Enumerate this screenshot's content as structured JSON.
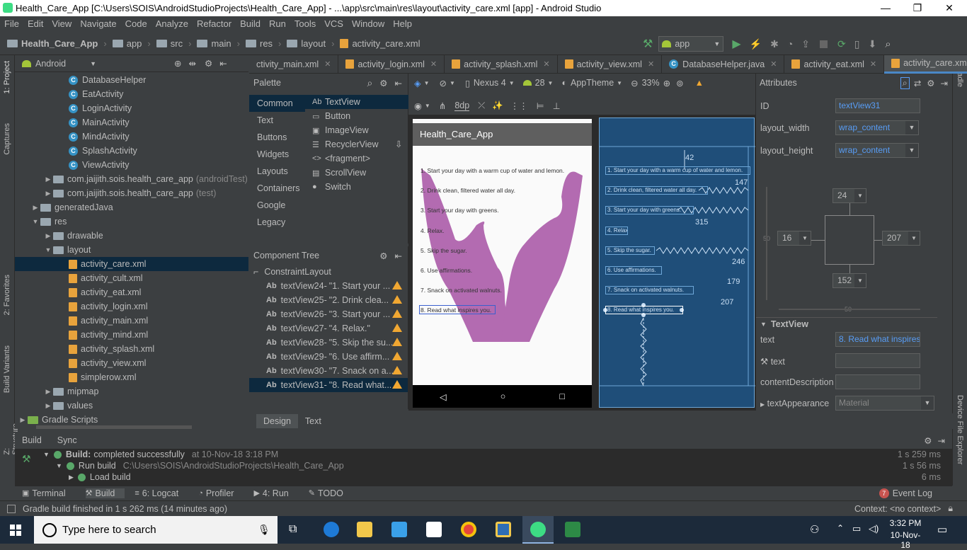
{
  "window": {
    "title": "Health_Care_App [C:\\Users\\SOIS\\AndroidStudioProjects\\Health_Care_App] - ...\\app\\src\\main\\res\\layout\\activity_care.xml [app] - Android Studio",
    "minimize": "—",
    "maximize": "❐",
    "close": "✕"
  },
  "menu": [
    "File",
    "Edit",
    "View",
    "Navigate",
    "Code",
    "Analyze",
    "Refactor",
    "Build",
    "Run",
    "Tools",
    "VCS",
    "Window",
    "Help"
  ],
  "breadcrumb": [
    "Health_Care_App",
    "app",
    "src",
    "main",
    "res",
    "layout",
    "activity_care.xml"
  ],
  "run_config": "app",
  "left_strip": {
    "project": "1: Project",
    "captures": "Captures",
    "favorites": "2: Favorites",
    "variants": "Build Variants",
    "structure": "Z: Structure"
  },
  "right_strip": {
    "gradle": "Gradle",
    "explorer": "Device File Explorer"
  },
  "project": {
    "view": "Android",
    "tree": [
      {
        "label": "DatabaseHelper",
        "kind": "class",
        "indent": 4
      },
      {
        "label": "EatActivity",
        "kind": "class",
        "indent": 4
      },
      {
        "label": "LoginActivity",
        "kind": "class",
        "indent": 4
      },
      {
        "label": "MainActivity",
        "kind": "class",
        "indent": 4
      },
      {
        "label": "MindActivity",
        "kind": "class",
        "indent": 4
      },
      {
        "label": "SplashActivity",
        "kind": "class",
        "indent": 4
      },
      {
        "label": "ViewActivity",
        "kind": "class",
        "indent": 4
      },
      {
        "label": "com.jaijith.sois.health_care_app",
        "suffix": "(androidTest)",
        "kind": "pkg",
        "indent": 2
      },
      {
        "label": "com.jaijith.sois.health_care_app",
        "suffix": "(test)",
        "kind": "pkg",
        "indent": 2
      },
      {
        "label": "generatedJava",
        "kind": "folder",
        "indent": 1
      },
      {
        "label": "res",
        "kind": "folder-open",
        "indent": 1
      },
      {
        "label": "drawable",
        "kind": "folder",
        "indent": 2
      },
      {
        "label": "layout",
        "kind": "folder-open",
        "indent": 2
      },
      {
        "label": "activity_care.xml",
        "kind": "xml",
        "indent": 4,
        "selected": true
      },
      {
        "label": "activity_cult.xml",
        "kind": "xml",
        "indent": 4
      },
      {
        "label": "activity_eat.xml",
        "kind": "xml",
        "indent": 4
      },
      {
        "label": "activity_login.xml",
        "kind": "xml",
        "indent": 4
      },
      {
        "label": "activity_main.xml",
        "kind": "xml",
        "indent": 4
      },
      {
        "label": "activity_mind.xml",
        "kind": "xml",
        "indent": 4
      },
      {
        "label": "activity_splash.xml",
        "kind": "xml",
        "indent": 4
      },
      {
        "label": "activity_view.xml",
        "kind": "xml",
        "indent": 4
      },
      {
        "label": "simplerow.xml",
        "kind": "xml",
        "indent": 4
      },
      {
        "label": "mipmap",
        "kind": "folder",
        "indent": 2
      },
      {
        "label": "values",
        "kind": "folder",
        "indent": 2
      },
      {
        "label": "Gradle Scripts",
        "kind": "gradle",
        "indent": 0
      }
    ]
  },
  "editor_tabs": [
    {
      "label": "ctivity_main.xml"
    },
    {
      "label": "activity_login.xml"
    },
    {
      "label": "activity_splash.xml"
    },
    {
      "label": "activity_view.xml"
    },
    {
      "label": "DatabaseHelper.java"
    },
    {
      "label": "activity_eat.xml"
    },
    {
      "label": "activity_care.xml",
      "active": true
    }
  ],
  "tab_overflow": "≡⁴",
  "palette": {
    "title": "Palette",
    "categories": [
      "Common",
      "Text",
      "Buttons",
      "Widgets",
      "Layouts",
      "Containers",
      "Google",
      "Legacy"
    ],
    "items": [
      {
        "icon": "Ab",
        "label": "TextView"
      },
      {
        "icon": "▭",
        "label": "Button"
      },
      {
        "icon": "▣",
        "label": "ImageView"
      },
      {
        "icon": "☰",
        "label": "RecyclerView"
      },
      {
        "icon": "<>",
        "label": "<fragment>"
      },
      {
        "icon": "▤",
        "label": "ScrollView"
      },
      {
        "icon": "●",
        "label": "Switch"
      }
    ]
  },
  "design_toolbar": {
    "device": "Nexus 4",
    "api": "28",
    "theme": "AppTheme",
    "zoom": "33%",
    "margin": "8dp"
  },
  "component_tree": {
    "title": "Component Tree",
    "root": "ConstraintLayout",
    "items": [
      {
        "id": "textView24-",
        "text": "\"1. Start your ..."
      },
      {
        "id": "textView25-",
        "text": "\"2. Drink clea..."
      },
      {
        "id": "textView26-",
        "text": "\"3. Start your ..."
      },
      {
        "id": "textView27-",
        "text": "\"4. Relax.\""
      },
      {
        "id": "textView28-",
        "text": "\"5. Skip the su..."
      },
      {
        "id": "textView29-",
        "text": "\"6. Use affirm..."
      },
      {
        "id": "textView30-",
        "text": "\"7. Snack on a..."
      },
      {
        "id": "textView31-",
        "text": "\"8. Read what...",
        "selected": true
      }
    ]
  },
  "phone": {
    "app_title": "Health_Care_App",
    "lines": [
      "1. Start your day with a warm cup of water and lemon.",
      "2. Drink clean, filtered water all day.",
      "3. Start your day with greens.",
      "4. Relax.",
      "5. Skip the sugar.",
      "6. Use affirmations.",
      "7. Snack on activated walnuts.",
      "8. Read what inspires you."
    ]
  },
  "blueprint": {
    "margins": [
      "42",
      "147",
      "315",
      "246",
      "179",
      "207"
    ],
    "lines": [
      "1. Start your day with a warm cup of water and lemon.",
      "2. Drink clean, filtered water all day.",
      "3. Start your day with greens.",
      "4. Relax.",
      "5. Skip the sugar.",
      "6. Use affirmations.",
      "7. Snack on activated walnuts.",
      "8. Read what inspires you."
    ]
  },
  "attributes": {
    "title": "Attributes",
    "id_label": "ID",
    "id_value": "textView31",
    "width_label": "layout_width",
    "width_value": "wrap_content",
    "height_label": "layout_height",
    "height_value": "wrap_content",
    "constraint": {
      "top": "24",
      "left": "16",
      "right": "207",
      "bottom": "152",
      "bias_v": "50",
      "bias_h": "50"
    },
    "section": "TextView",
    "text_label": "text",
    "text_value": "8. Read what inspires",
    "text2_label": "text",
    "desc_label": "contentDescription",
    "appearance_label": "textAppearance",
    "appearance_value": "Material"
  },
  "design_tabs": [
    "Design",
    "Text"
  ],
  "build": {
    "tabs": [
      "Build",
      "Sync"
    ],
    "rows": [
      {
        "label": "Build:",
        "strong": "completed successfully",
        "extra": "at 10-Nov-18 3:18 PM",
        "time": "1 s 259 ms"
      },
      {
        "label": "Run build",
        "extra": "C:\\Users\\SOIS\\AndroidStudioProjects\\Health_Care_App",
        "time": "1 s 56 ms"
      },
      {
        "label": "Load build",
        "extra": "",
        "time": "6 ms"
      }
    ]
  },
  "tool_windows": [
    "Terminal",
    "Build",
    "6: Logcat",
    "Profiler",
    "4: Run",
    "TODO"
  ],
  "event_log": {
    "count": "7",
    "label": "Event Log"
  },
  "status": {
    "message": "Gradle build finished in 1 s 262 ms (14 minutes ago)",
    "context": "Context: <no context>"
  },
  "taskbar": {
    "search_placeholder": "Type here to search",
    "time": "3:32 PM",
    "date": "10-Nov-18"
  }
}
